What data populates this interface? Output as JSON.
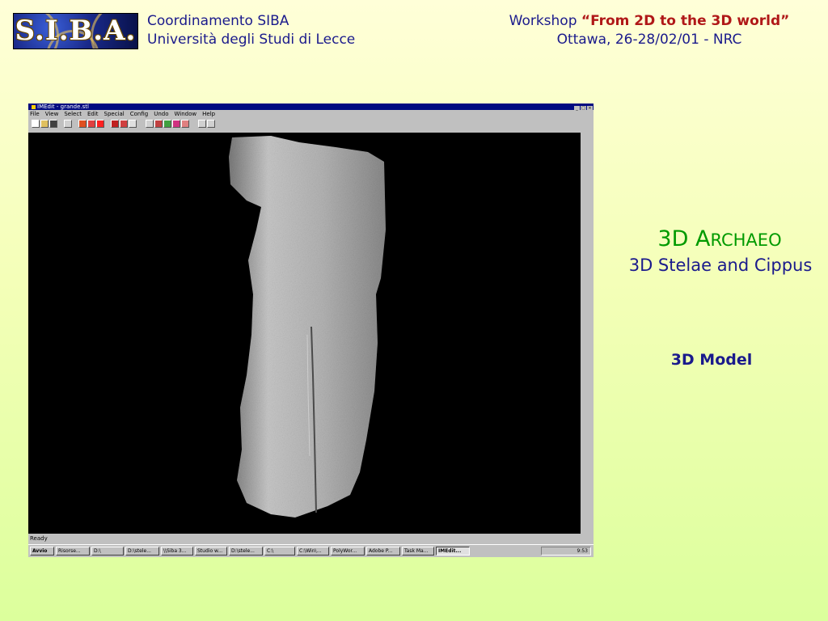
{
  "header": {
    "logo_text": "S.I.B.A.",
    "left_line1": "Coordinamento SIBA",
    "left_line2": "Università degli Studi di Lecce",
    "right_prefix": "Workshop ",
    "right_quote": "“From 2D to the 3D world”",
    "right_line2": "Ottawa, 26-28/02/01 - NRC"
  },
  "slide": {
    "title_3d": "3D ",
    "title_a": "A",
    "title_rest": "RCHAEO",
    "subtitle": "3D Stelae and Cippus",
    "caption": "3D Model"
  },
  "app_window": {
    "title": "IMEdit - grande.stl",
    "menu": [
      "File",
      "View",
      "Select",
      "Edit",
      "Special",
      "Config",
      "Undo",
      "Window",
      "Help"
    ],
    "status": "Ready",
    "taskbar": [
      {
        "label": "Avvio"
      },
      {
        "label": "Risorse..."
      },
      {
        "label": "D:\\"
      },
      {
        "label": "D:\\stele..."
      },
      {
        "label": "\\\\Siba 3..."
      },
      {
        "label": "Studio w..."
      },
      {
        "label": "D:\\stele..."
      },
      {
        "label": "C:\\"
      },
      {
        "label": "C:\\Win\\..."
      },
      {
        "label": "PolyWor..."
      },
      {
        "label": "Adobe P..."
      },
      {
        "label": "Task Ma..."
      },
      {
        "label": "IMEdit..."
      }
    ],
    "clock": "9:53"
  }
}
